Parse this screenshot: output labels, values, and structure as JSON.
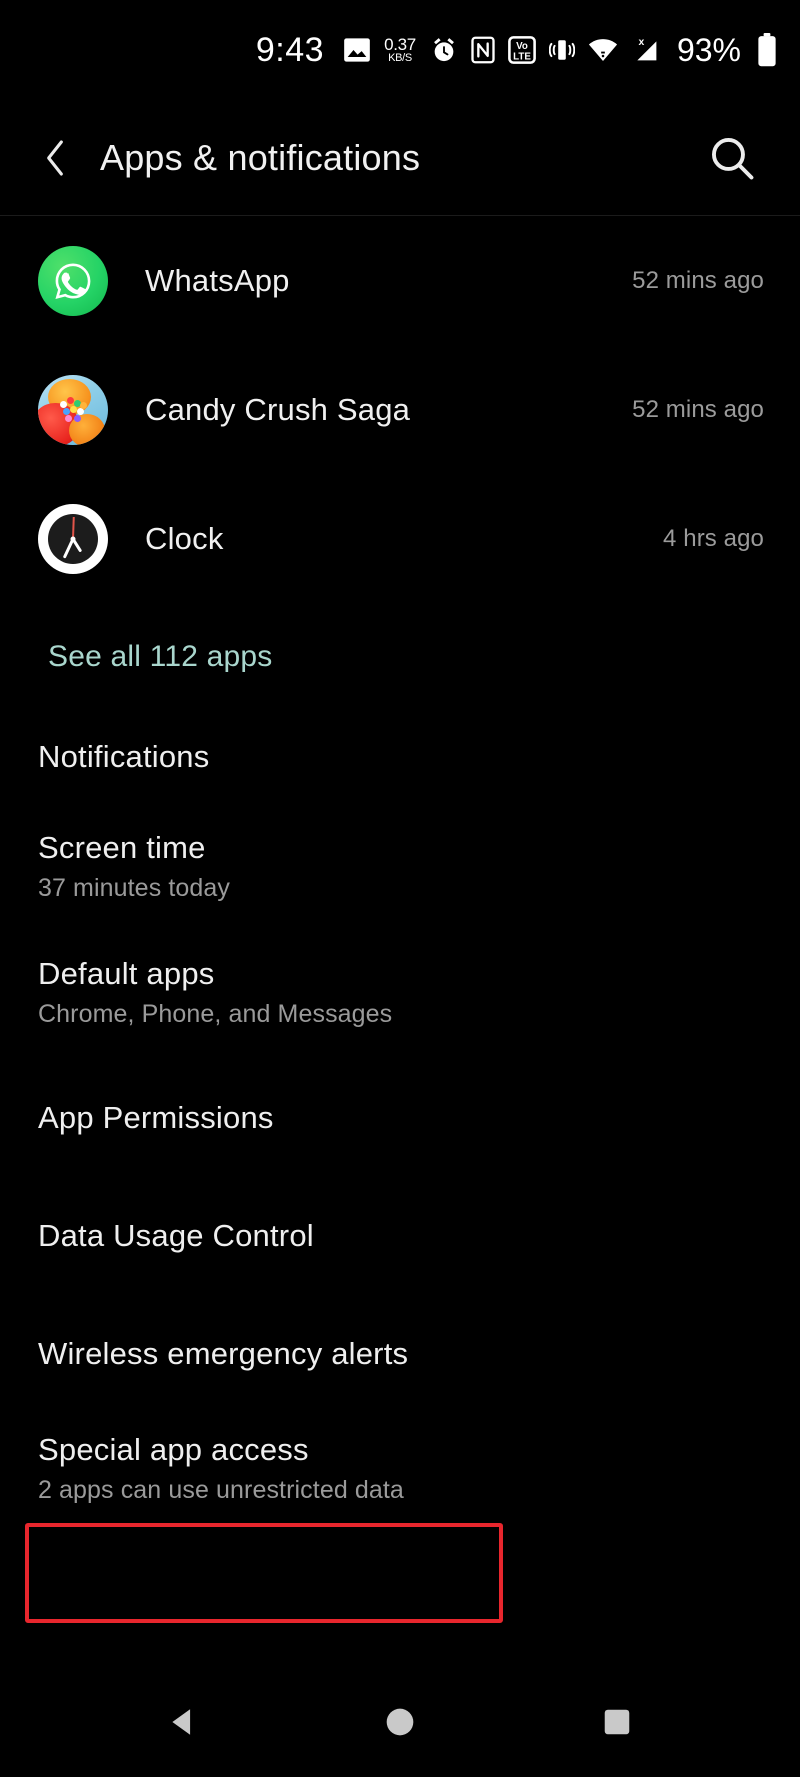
{
  "status_bar": {
    "time": "9:43",
    "photo_icon": "photo-icon",
    "data_speed_value": "0.37",
    "data_speed_unit": "KB/S",
    "alarm_icon": "alarm-icon",
    "nfc_icon": "nfc-icon",
    "volte_icon": "volte-icon",
    "volte_top_label": "Vo",
    "volte_bottom_label": "LTE",
    "vibrate_icon": "vibrate-icon",
    "wifi_icon": "wifi-icon",
    "signal_icon": "signal-no-sim-icon",
    "signal_badge": "x",
    "battery_percent": "93%",
    "battery_icon": "battery-full-icon"
  },
  "header": {
    "back_icon": "back-chevron-icon",
    "title": "Apps & notifications",
    "search_icon": "search-icon"
  },
  "recent_apps": [
    {
      "name": "WhatsApp",
      "time": "52 mins ago",
      "icon": "whatsapp-icon"
    },
    {
      "name": "Candy Crush Saga",
      "time": "52 mins ago",
      "icon": "candy-crush-saga-icon"
    },
    {
      "name": "Clock",
      "time": "4 hrs ago",
      "icon": "clock-icon"
    }
  ],
  "see_all": {
    "label": "See all 112 apps",
    "color": "#a9d6cd"
  },
  "settings_items": [
    {
      "title": "Notifications",
      "subtitle": ""
    },
    {
      "title": "Screen time",
      "subtitle": "37 minutes today"
    },
    {
      "title": "Default apps",
      "subtitle": "Chrome, Phone, and Messages"
    },
    {
      "title": "App Permissions",
      "subtitle": ""
    },
    {
      "title": "Data Usage Control",
      "subtitle": ""
    },
    {
      "title": "Wireless emergency alerts",
      "subtitle": ""
    },
    {
      "title": "Special app access",
      "subtitle": "2 apps can use unrestricted data"
    }
  ],
  "highlight": {
    "target": "Special app access",
    "color": "#e8262d"
  },
  "nav_bar": {
    "back_icon": "nav-back-triangle-icon",
    "home_icon": "nav-home-circle-icon",
    "recents_icon": "nav-recents-square-icon"
  }
}
